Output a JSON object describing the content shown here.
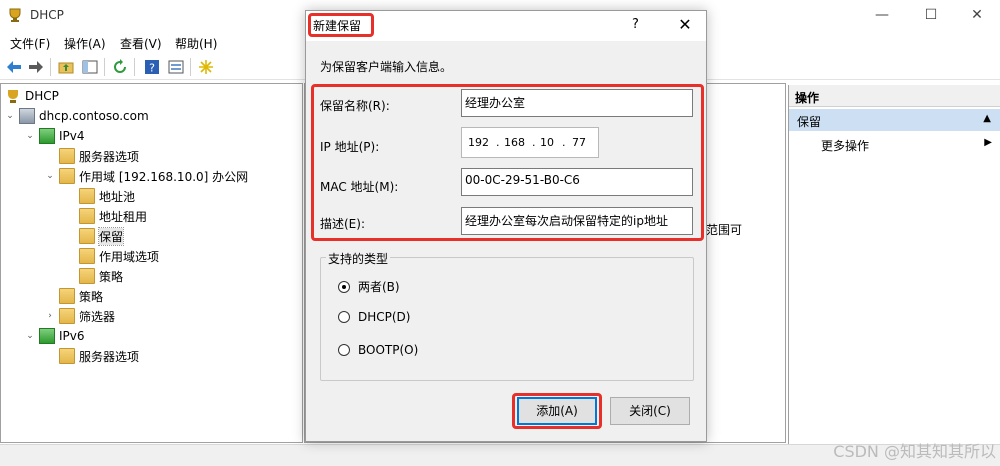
{
  "window": {
    "title": "DHCP",
    "buttons": {
      "minimize": "—",
      "maximize": "☐",
      "close": "✕"
    }
  },
  "menubar": [
    "文件(F)",
    "操作(A)",
    "查看(V)",
    "帮助(H)"
  ],
  "toolbar": [
    "back-icon",
    "forward-icon",
    "folder-up-icon",
    "show-tree-icon",
    "refresh-icon",
    "help-icon",
    "properties-icon",
    "star-icon"
  ],
  "tree": [
    {
      "label": "DHCP",
      "icon": "dhcp-icon"
    },
    {
      "label": "dhcp.contoso.com",
      "icon": "server-icon"
    },
    {
      "label": "IPv4",
      "icon": "ipv4-icon"
    },
    {
      "label": "服务器选项",
      "icon": "options-icon"
    },
    {
      "label": "作用域 [192.168.10.0] 办公网",
      "icon": "folder-icon"
    },
    {
      "label": "地址池",
      "icon": "pool-icon"
    },
    {
      "label": "地址租用",
      "icon": "lease-icon"
    },
    {
      "label": "保留",
      "icon": "reservation-icon"
    },
    {
      "label": "作用域选项",
      "icon": "options-icon"
    },
    {
      "label": "策略",
      "icon": "policy-icon"
    },
    {
      "label": "策略",
      "icon": "policy-icon"
    },
    {
      "label": "筛选器",
      "icon": "filter-icon"
    },
    {
      "label": "IPv6",
      "icon": "ipv6-icon"
    },
    {
      "label": "服务器选项",
      "icon": "options-icon"
    }
  ],
  "middle": {
    "fragment_text": "范围可"
  },
  "actions_pane": {
    "header": "操作",
    "section": "保留",
    "item": "更多操作"
  },
  "dialog": {
    "title": "新建保留",
    "help": "?",
    "close": "✕",
    "intro": "为保留客户端输入信息。",
    "fields": {
      "name_label": "保留名称(R):",
      "name_value": "经理办公室",
      "ip_label": "IP 地址(P):",
      "ip_parts": [
        "192",
        "168",
        "10",
        "77"
      ],
      "mac_label": "MAC 地址(M):",
      "mac_value": "00-0C-29-51-B0-C6",
      "desc_label": "描述(E):",
      "desc_value": "经理办公室每次启动保留特定的ip地址"
    },
    "type_group": {
      "label": "支持的类型",
      "options": [
        "两者(B)",
        "DHCP(D)",
        "BOOTP(O)"
      ],
      "selected": "两者(B)"
    },
    "buttons": {
      "add": "添加(A)",
      "close": "关闭(C)"
    },
    "highlight_color": "#e8302a"
  },
  "watermark": "CSDN @知其知其所以"
}
